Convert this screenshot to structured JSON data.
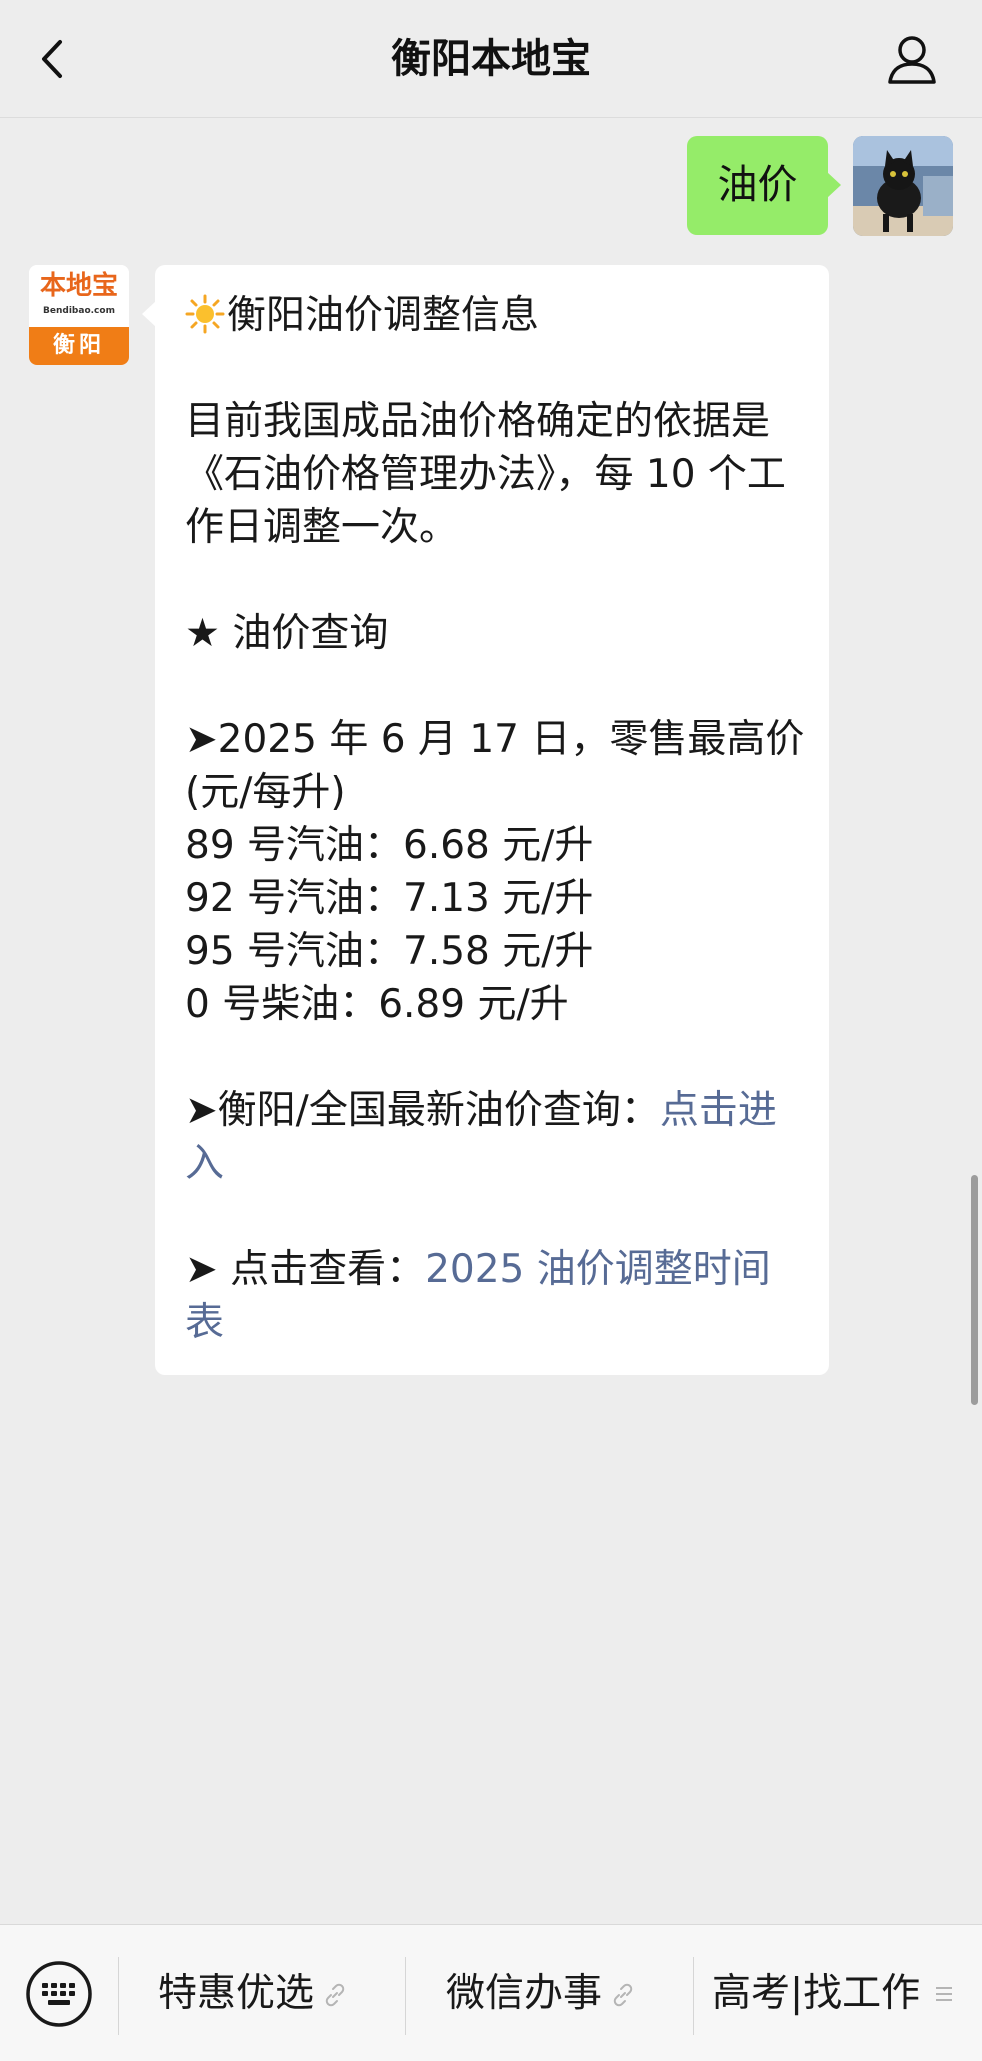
{
  "header": {
    "title": "衡阳本地宝",
    "back_icon": "chevron-left-icon",
    "profile_icon": "person-icon"
  },
  "user_message": {
    "text": "油价",
    "bubble_color": "#95ec69"
  },
  "official_account": {
    "logo_name": "本地宝",
    "logo_sub": "Bendibao.com",
    "logo_city": "衡阳",
    "brand_color": "#f07d16"
  },
  "message": {
    "title": "衡阳油价调整信息",
    "intro_lines": [
      "目前我国成品油价格确定的依据是",
      "《石油价格管理办法》，每 10 个工",
      "作日调整一次。"
    ],
    "section_heading": "★ 油价查询",
    "date_lines": [
      "➤2025 年 6 月 17 日，零售最高价",
      "(元/每升)"
    ],
    "prices": [
      "89 号汽油：6.68 元/升",
      "92 号汽油：7.13 元/升",
      "95 号汽油：7.58 元/升",
      "0 号柴油：6.89 元/升"
    ],
    "query_prefix": "➤衡阳/全国最新油价查询：",
    "query_link_1": "点击进",
    "query_link_2": "入",
    "view_prefix": "➤ 点击查看：",
    "view_link_1": "2025 油价调整时间",
    "view_link_2": "表",
    "link_color": "#576b95"
  },
  "bottom_menu": {
    "keyboard_icon": "keyboard-icon",
    "items": [
      {
        "label": "特惠优选",
        "icon": "link-icon"
      },
      {
        "label": "微信办事",
        "icon": "link-icon"
      },
      {
        "label": "高考|找工作",
        "icon": "menu-icon"
      }
    ]
  }
}
